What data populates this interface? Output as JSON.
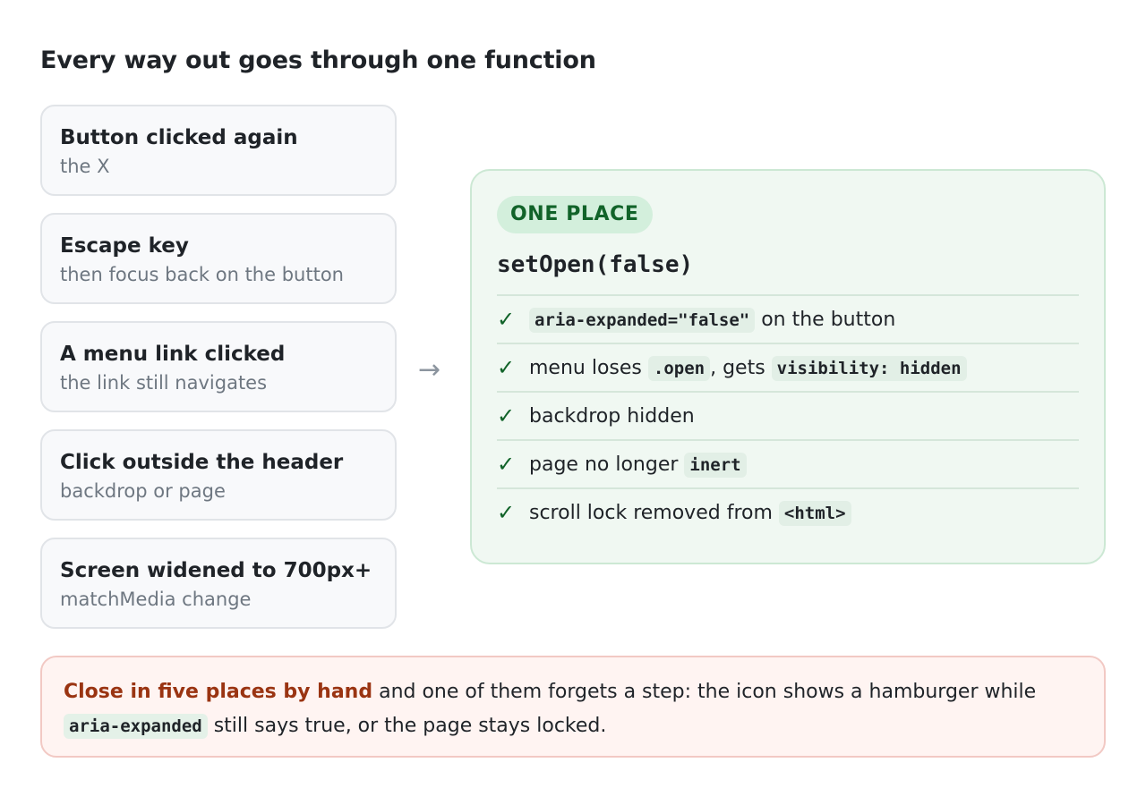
{
  "title": "Every way out goes through one function",
  "triggers": [
    {
      "title": "Button clicked again",
      "sub": "the X"
    },
    {
      "title": "Escape key",
      "sub": "then focus back on the button"
    },
    {
      "title": "A menu link clicked",
      "sub": "the link still navigates"
    },
    {
      "title": "Click outside the header",
      "sub": "backdrop or page"
    },
    {
      "title": "Screen widened to 700px+",
      "sub": "matchMedia change"
    }
  ],
  "arrow": "→",
  "panel": {
    "badge": "ONE PLACE",
    "function": "setOpen(false)",
    "check_mark": "✓",
    "steps": [
      {
        "code": "aria-expanded=\"false\"",
        "text": " on the button"
      },
      {
        "text_before": "menu loses ",
        "code1": ".open",
        "text_mid": ", gets ",
        "code2": "visibility: hidden"
      },
      {
        "text": "backdrop hidden"
      },
      {
        "text": "page no longer ",
        "code": "inert"
      },
      {
        "text": "scroll lock removed from ",
        "code": "<html>"
      }
    ]
  },
  "warning": {
    "strong": "Close in five places by hand",
    "text1": " and one of them forgets a step: the icon shows a hamburger while ",
    "code": "aria-expanded",
    "text2": " still says true, or the page stays locked."
  },
  "colors": {
    "accent_green": "#116329",
    "warning_red": "#9a3412",
    "panel_bg": "#f0f8f2",
    "warning_bg": "#fff4f2"
  }
}
